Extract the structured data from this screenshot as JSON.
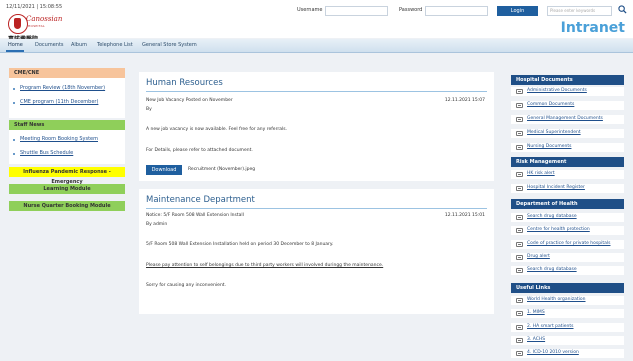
{
  "header": {
    "datetime": "12/11/2021 | 15:08:55",
    "logo": {
      "script": "Canossian",
      "subtitle": "HOSPITAL",
      "chinese": "嘉諾撒醫院"
    },
    "username_label": "Username",
    "password_label": "Password",
    "login_label": "Login",
    "search_placeholder": "Please enter keywords",
    "brand": "Intranet"
  },
  "nav": [
    "Home",
    "Documents",
    "Album",
    "Telephone List",
    "General Store System"
  ],
  "left": {
    "cme_title": "CME/CNE",
    "cme_links": [
      "Program Review (18th November)",
      "CME program (11th December)"
    ],
    "staff_title": "Staff News",
    "staff_links": [
      "Meeting Room Booking System",
      "Shuttle Bus Schedule"
    ],
    "banner_flu": "Influenza Pandemic Response - Emergency",
    "banner_learning": "Learning Module",
    "banner_nurse": "Nurse Quarter Booking Module"
  },
  "posts": [
    {
      "title": "Human Resources",
      "subject": "New Job Vacancy Posted on November",
      "date": "12.11.2021 15:07",
      "author": "By",
      "line1": "A new job vacancy is now available. Feel free for any referrals.",
      "line2": "For Details, please refer to attached document.",
      "download_label": "Download",
      "attachment": "Recruitment (November).jpeg"
    },
    {
      "title": "Maintenance Department",
      "subject": "Notice: 5/F  Room 508 Wall Extension Install",
      "date": "12.11.2021 15:01",
      "author": "By admin",
      "line1": "5/F  Room 508 Wall Extension Installation held on period 30 December to 8 January.",
      "line2": "Please pay attention to self belongings due to third party workers will involved duringg the maintenance.",
      "line3": "Sorry for causing any inconvenient."
    }
  ],
  "right": {
    "sections": [
      {
        "title": "Hospital Documents",
        "items": [
          "Administrative Documents",
          "Common Documents",
          "General Management Documents",
          "Medical Superintendent",
          "Nursing Documents"
        ]
      },
      {
        "title": "Risk Management",
        "items": [
          "HK risk alert",
          "Hospital Incident Register"
        ]
      },
      {
        "title": "Department of Health",
        "items": [
          "Search drug database",
          "Centre for health protection",
          "Code of practice for private hospitals",
          "Drug alert",
          "Search drug database"
        ]
      },
      {
        "title": "Useful Links",
        "items": [
          "World Health organization",
          "1. MIMS",
          "2. HA smart patients",
          "3. ACHS",
          "4. ICD-10 2010 version"
        ]
      }
    ]
  },
  "colors": {
    "nav_accent": "#2c6fb3",
    "cme_header": "#f7c49b",
    "staff_header": "#8fcf5a",
    "flu_banner": "#ffff00",
    "learning_banner": "#8fcf5a",
    "nurse_banner": "#8fcf5a",
    "right_header": "#1f4f87",
    "button": "#1f5f9f"
  }
}
